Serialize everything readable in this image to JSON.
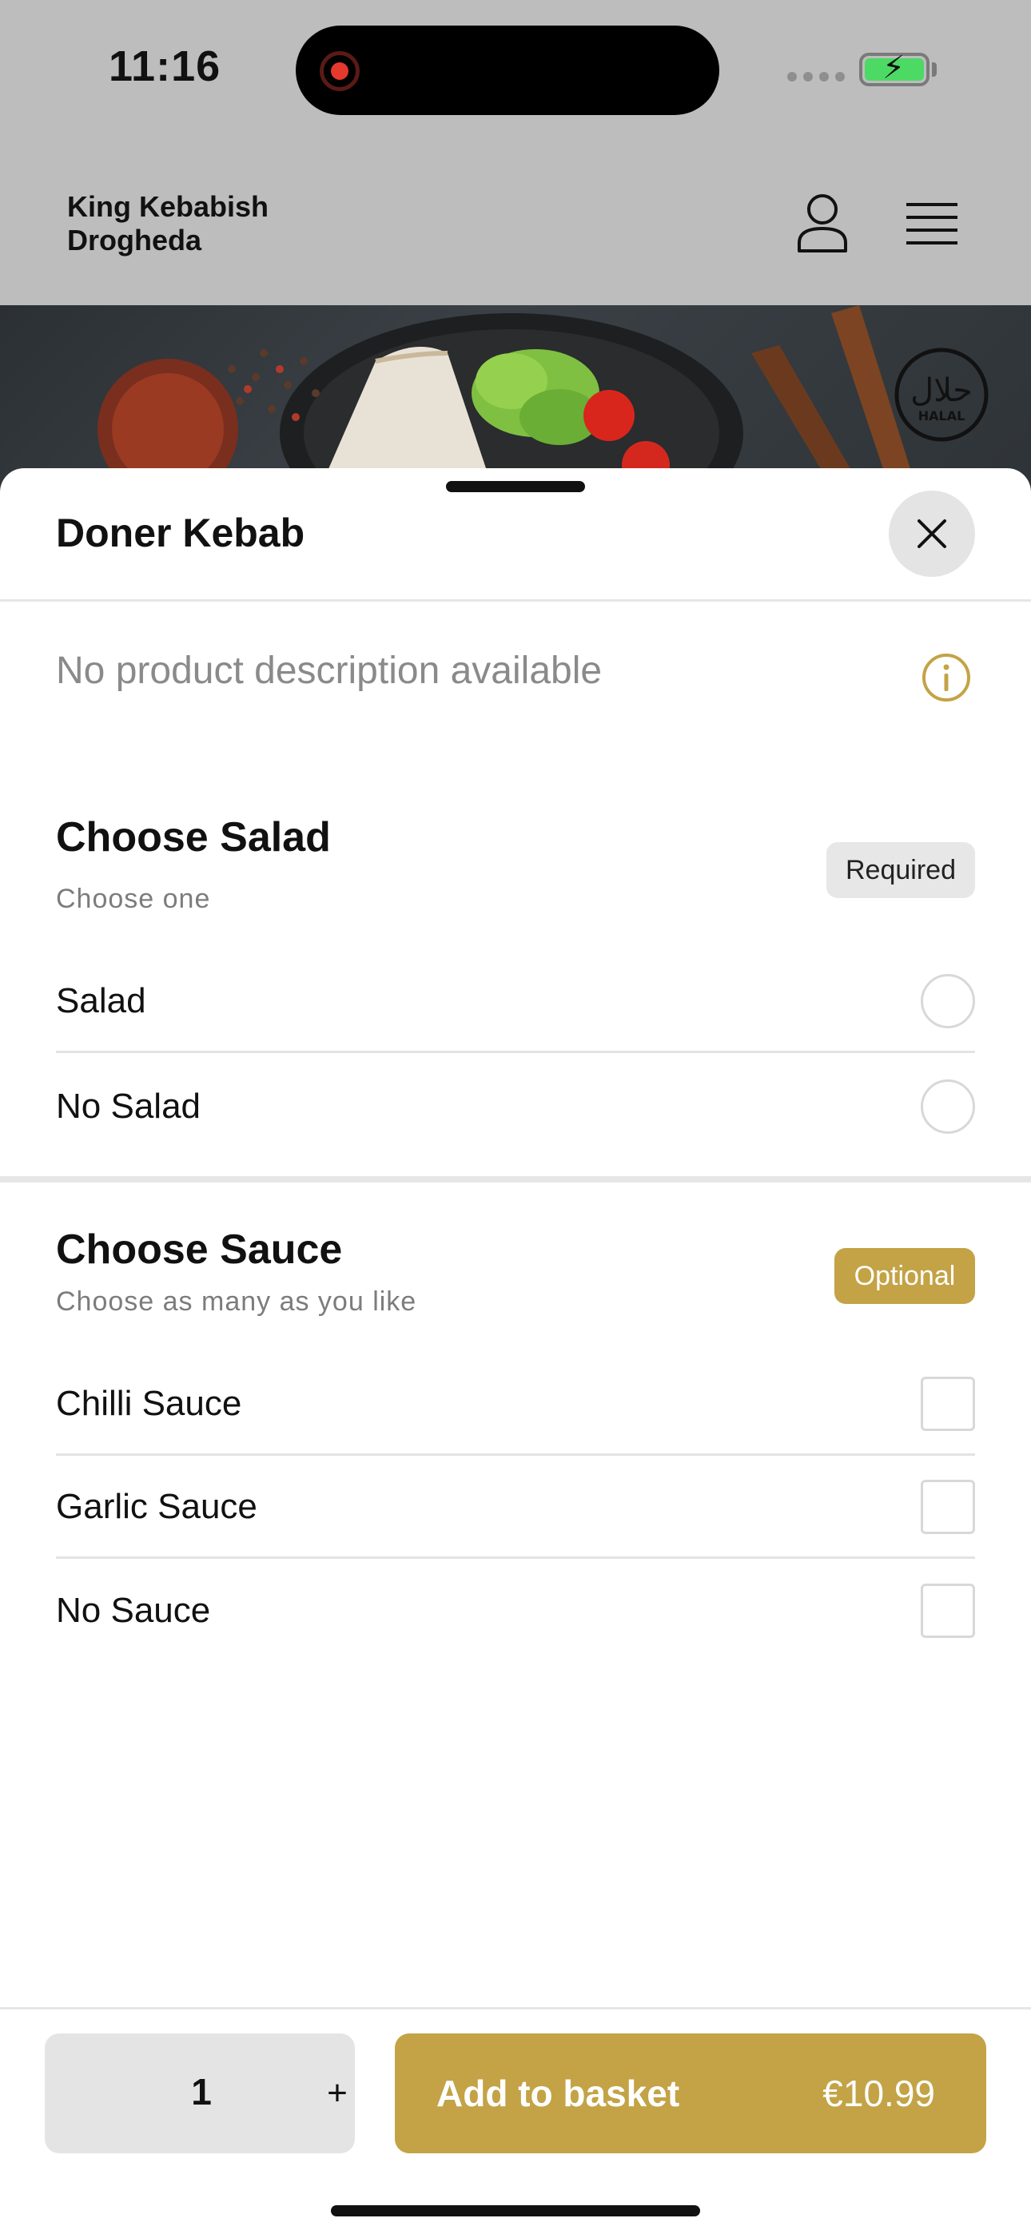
{
  "status_bar": {
    "time": "11:16",
    "battery_color": "#4cd964",
    "recording_indicator_color": "#e5382e"
  },
  "header": {
    "brand_line1": "King Kebabish",
    "brand_line2": "Drogheda",
    "icons": [
      "user-icon",
      "menu-icon"
    ]
  },
  "hero": {
    "halal_logo_text": "HALAL"
  },
  "sheet": {
    "title": "Doner Kebab",
    "close_icon": "close-icon",
    "description": "No product description available",
    "info_icon": "info-icon"
  },
  "salad_group": {
    "title": "Choose Salad",
    "subtitle": "Choose one",
    "badge": "Required",
    "options": [
      {
        "label": "Salad",
        "selected": false
      },
      {
        "label": "No Salad",
        "selected": false
      }
    ]
  },
  "sauce_group": {
    "title": "Choose Sauce",
    "subtitle": "Choose as many as you like",
    "badge": "Optional",
    "options": [
      {
        "label": "Chilli Sauce",
        "checked": false
      },
      {
        "label": "Garlic Sauce",
        "checked": false
      },
      {
        "label": "No Sauce",
        "checked": false
      }
    ]
  },
  "footer": {
    "quantity": "1",
    "plus_label": "+",
    "add_label": "Add to basket",
    "price": "€10.99"
  },
  "colors": {
    "accent": "#c3a346",
    "backdrop": "#bdbdbd",
    "required_badge_bg": "#e7e7e7"
  }
}
